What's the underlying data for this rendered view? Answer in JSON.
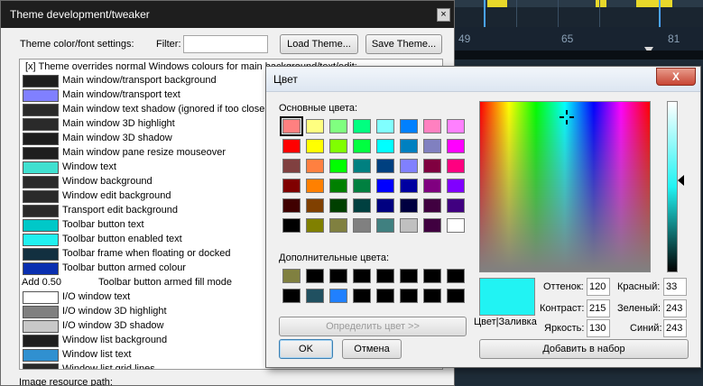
{
  "tweaker": {
    "title": "Theme development/tweaker",
    "close_glyph": "×",
    "section_label": "Theme color/font settings:",
    "filter_label": "Filter:",
    "filter_value": "",
    "load_button": "Load Theme...",
    "save_button": "Save Theme...",
    "header_text": "[x]  Theme overrides normal Windows colours for main background/text/edit:",
    "items": [
      {
        "label": "Main window/transport background",
        "color": "#1e1e1e"
      },
      {
        "label": "Main window/transport text",
        "color": "#8080ff"
      },
      {
        "label": "Main window text shadow (ignored if too close to",
        "color": "#2a2a2a"
      },
      {
        "label": "Main window 3D highlight",
        "color": "#2a2a2a"
      },
      {
        "label": "Main window 3D shadow",
        "color": "#1e1e1e"
      },
      {
        "label": "Main window pane resize mouseover",
        "color": "#1e1e1e"
      },
      {
        "label": "Window text",
        "color": "#40e0d0"
      },
      {
        "label": "Window background",
        "color": "#2a2a2a"
      },
      {
        "label": "Window edit background",
        "color": "#2a2a2a"
      },
      {
        "label": "Transport edit background",
        "color": "#2a2a2a"
      },
      {
        "label": "Toolbar button text",
        "color": "#00c8c8"
      },
      {
        "label": "Toolbar button enabled text",
        "color": "#20f0f0"
      },
      {
        "label": "Toolbar frame when floating or docked",
        "color": "#123040"
      },
      {
        "label": "Toolbar button armed colour",
        "color": "#0a2fb0"
      }
    ],
    "add_value": "Add 0.50",
    "armed_fill_label": "Toolbar button armed fill mode",
    "items2": [
      {
        "label": "I/O window text",
        "color": "#ffffff"
      },
      {
        "label": "I/O window 3D highlight",
        "color": "#808080"
      },
      {
        "label": "I/O window 3D shadow",
        "color": "#c8c8c8"
      },
      {
        "label": "Window list background",
        "color": "#1e1e1e"
      },
      {
        "label": "Window list text",
        "color": "#3090d0"
      },
      {
        "label": "Window list grid lines",
        "color": "#2a2a2a"
      }
    ],
    "image_path_label": "Image resource path:"
  },
  "daw": {
    "ruler_numbers": [
      "49",
      "65",
      "81"
    ]
  },
  "color_dialog": {
    "title": "Цвет",
    "close_glyph": "X",
    "basic_label": "Основные цвета:",
    "basic_colors": [
      "#ff8080",
      "#ffff80",
      "#80ff80",
      "#00ff80",
      "#80ffff",
      "#0080ff",
      "#ff80c0",
      "#ff80ff",
      "#ff0000",
      "#ffff00",
      "#80ff00",
      "#00ff40",
      "#00ffff",
      "#0080c0",
      "#8080c0",
      "#ff00ff",
      "#804040",
      "#ff8040",
      "#00ff00",
      "#008080",
      "#004080",
      "#8080ff",
      "#800040",
      "#ff0080",
      "#800000",
      "#ff8000",
      "#008000",
      "#008040",
      "#0000ff",
      "#0000a0",
      "#800080",
      "#8000ff",
      "#400000",
      "#804000",
      "#004000",
      "#004040",
      "#000080",
      "#000040",
      "#400040",
      "#400080",
      "#000000",
      "#808000",
      "#808040",
      "#808080",
      "#408080",
      "#c0c0c0",
      "#400040",
      "#ffffff"
    ],
    "custom_label": "Дополнительные цвета:",
    "custom_colors": [
      "#808040",
      "#000000",
      "#000000",
      "#000000",
      "#000000",
      "#000000",
      "#000000",
      "#000000",
      "#000000",
      "#205060",
      "#2080ff",
      "#000000",
      "#000000",
      "#000000",
      "#000000",
      "#000000"
    ],
    "define_button": "Определить цвет >>",
    "ok_button": "OK",
    "cancel_button": "Отмена",
    "preview_color": "#21f3f3",
    "preview_label": "Цвет|Заливка",
    "hue_label": "Оттенок:",
    "hue_value": "120",
    "sat_label": "Контраст:",
    "sat_value": "215",
    "lum_label": "Яркость:",
    "lum_value": "130",
    "red_label": "Красный:",
    "red_value": "33",
    "green_label": "Зеленый:",
    "green_value": "243",
    "blue_label": "Синий:",
    "blue_value": "243",
    "add_custom_button": "Добавить в набор"
  }
}
